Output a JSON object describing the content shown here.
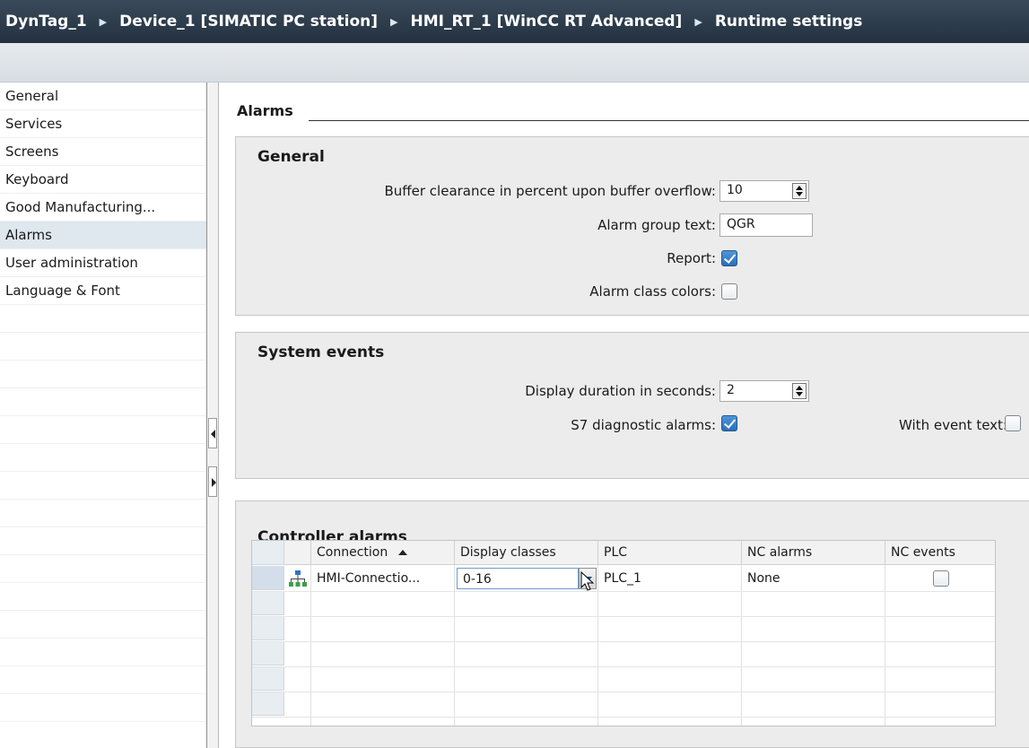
{
  "breadcrumb": [
    "DynTag_1",
    "Device_1 [SIMATIC PC station]",
    "HMI_RT_1 [WinCC RT Advanced]",
    "Runtime settings"
  ],
  "nav": {
    "items": [
      {
        "label": "General",
        "selected": false
      },
      {
        "label": "Services",
        "selected": false
      },
      {
        "label": "Screens",
        "selected": false
      },
      {
        "label": "Keyboard",
        "selected": false
      },
      {
        "label": "Good Manufacturing...",
        "selected": false
      },
      {
        "label": "Alarms",
        "selected": true
      },
      {
        "label": "User administration",
        "selected": false
      },
      {
        "label": "Language & Font",
        "selected": false
      }
    ]
  },
  "main": {
    "section_title": "Alarms",
    "general": {
      "title": "General",
      "buffer_label": "Buffer clearance in percent upon buffer overflow:",
      "buffer_value": "10",
      "group_text_label": "Alarm group text:",
      "group_text_value": "QGR",
      "report_label": "Report:",
      "report_checked": true,
      "class_colors_label": "Alarm class colors:",
      "class_colors_checked": false
    },
    "system_events": {
      "title": "System events",
      "duration_label": "Display duration in seconds:",
      "duration_value": "2",
      "s7_label": "S7 diagnostic alarms:",
      "s7_checked": true,
      "event_text_label": "With event text:",
      "event_text_checked": false
    },
    "controller_alarms": {
      "title": "Controller alarms",
      "columns": [
        "Connection",
        "Display classes",
        "PLC",
        "NC alarms",
        "NC events"
      ],
      "rows": [
        {
          "connection": "HMI-Connectio...",
          "display_classes": "0-16",
          "plc": "PLC_1",
          "nc_alarms": "None",
          "nc_events": false
        }
      ]
    }
  },
  "colors": {
    "accent": "#2b6fb6",
    "titlebar": "#233140",
    "panel": "#ececec"
  }
}
